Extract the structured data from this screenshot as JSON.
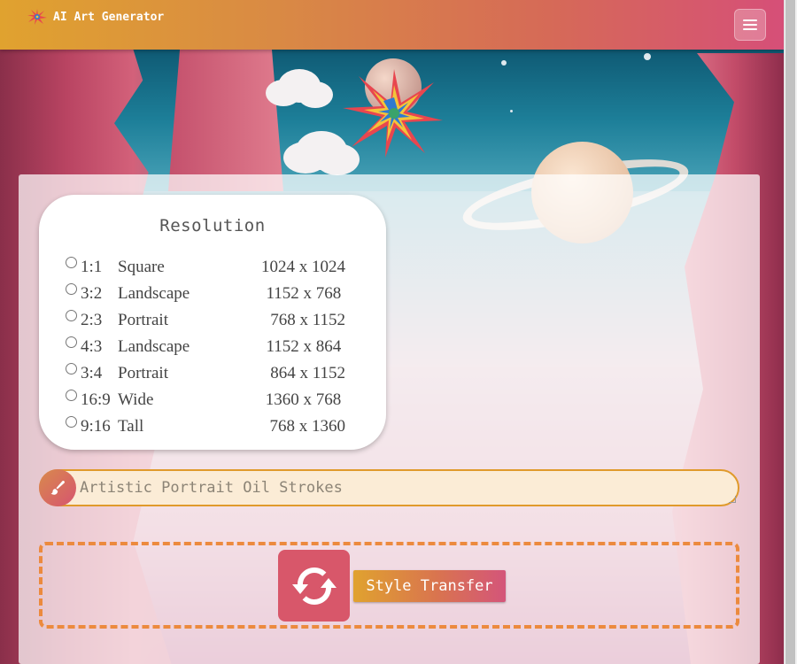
{
  "app": {
    "title": "AI Art Generator"
  },
  "navbar": {
    "menu_icon": "hamburger-menu-icon"
  },
  "resolution": {
    "title": "Resolution",
    "options": [
      {
        "ratio": "1:1",
        "name": "Square",
        "size": "1024 x 1024"
      },
      {
        "ratio": "3:2",
        "name": "Landscape",
        "size": "1152 x 768 "
      },
      {
        "ratio": "2:3",
        "name": "Portrait",
        "size": " 768 x 1152"
      },
      {
        "ratio": "4:3",
        "name": "Landscape",
        "size": "1152 x 864 "
      },
      {
        "ratio": "3:4",
        "name": "Portrait",
        "size": " 864 x 1152"
      },
      {
        "ratio": "16:9",
        "name": "Wide",
        "size": "1360 x 768 "
      },
      {
        "ratio": "9:16",
        "name": "Tall",
        "size": " 768 x 1360"
      }
    ],
    "selected": null
  },
  "prompt": {
    "placeholder": "Artistic Portrait Oil Strokes",
    "value": "",
    "icon": "paintbrush-icon"
  },
  "actions": {
    "refresh_icon": "refresh-icon",
    "style_transfer_label": "Style Transfer"
  },
  "colors": {
    "header_gradient_start": "#e0a22f",
    "header_gradient_end": "#d64f78",
    "prompt_border": "#e09a2b",
    "prompt_background": "#fbecd6",
    "dropzone_border": "#ec8a3e",
    "refresh_button": "#d8576a"
  }
}
